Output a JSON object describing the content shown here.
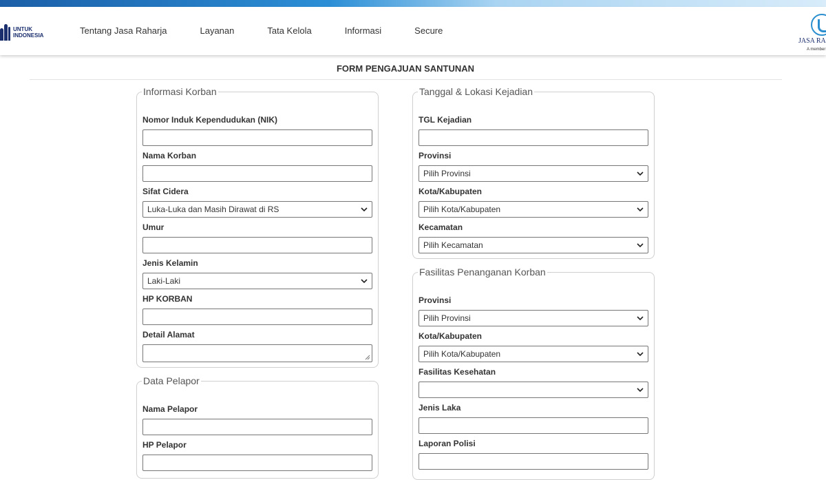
{
  "header": {
    "logo_left": {
      "line1": "UNTUK",
      "line2": "INDONESIA"
    },
    "nav": [
      {
        "label": "Tentang Jasa Raharja"
      },
      {
        "label": "Layanan"
      },
      {
        "label": "Tata Kelola"
      },
      {
        "label": "Informasi"
      },
      {
        "label": "Secure"
      }
    ],
    "logo_right": {
      "name": "JASA RAI",
      "sub": "A member"
    }
  },
  "page_title": "FORM PENGAJUAN SANTUNAN",
  "informasi_korban": {
    "legend": "Informasi Korban",
    "nik_label": "Nomor Induk Kependudukan (NIK)",
    "nik_value": "",
    "nama_label": "Nama Korban",
    "nama_value": "",
    "sifat_label": "Sifat Cidera",
    "sifat_value": "Luka-Luka dan Masih Dirawat di RS",
    "umur_label": "Umur",
    "umur_value": "",
    "jk_label": "Jenis Kelamin",
    "jk_value": "Laki-Laki",
    "hp_label": "HP KORBAN",
    "hp_value": "",
    "alamat_label": "Detail Alamat",
    "alamat_value": ""
  },
  "data_pelapor": {
    "legend": "Data Pelapor",
    "nama_label": "Nama Pelapor",
    "nama_value": "",
    "hp_label": "HP Pelapor",
    "hp_value": ""
  },
  "lokasi_kejadian": {
    "legend": "Tanggal & Lokasi Kejadian",
    "tgl_label": "TGL Kejadian",
    "tgl_value": "",
    "prov_label": "Provinsi",
    "prov_value": "Pilih Provinsi",
    "kota_label": "Kota/Kabupaten",
    "kota_value": "Pilih Kota/Kabupaten",
    "kec_label": "Kecamatan",
    "kec_value": "Pilih Kecamatan"
  },
  "fasilitas": {
    "legend": "Fasilitas Penanganan Korban",
    "prov_label": "Provinsi",
    "prov_value": "Pilih Provinsi",
    "kota_label": "Kota/Kabupaten",
    "kota_value": "Pilih Kota/Kabupaten",
    "faskes_label": "Fasilitas Kesehatan",
    "faskes_value": "",
    "laka_label": "Jenis Laka",
    "laka_value": "",
    "polisi_label": "Laporan Polisi",
    "polisi_value": ""
  }
}
